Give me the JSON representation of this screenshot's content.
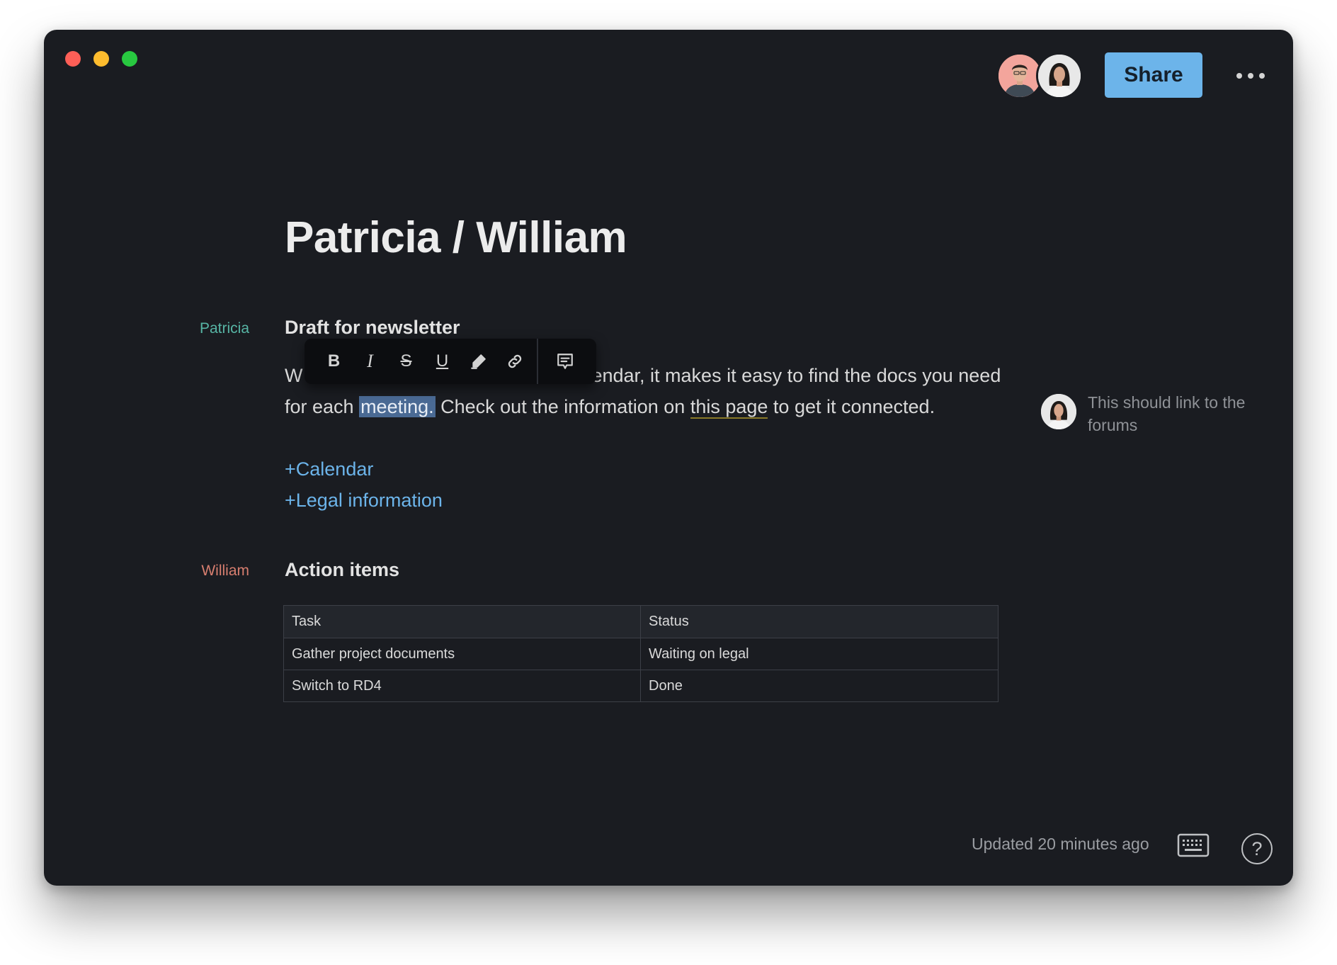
{
  "window": {
    "traffic_lights": [
      "close",
      "minimize",
      "maximize"
    ],
    "colors": {
      "close": "#fe5f57",
      "minimize": "#febc2e",
      "maximize": "#28c840",
      "background": "#1a1c21"
    }
  },
  "header": {
    "collaborators": [
      {
        "icon": "user-avatar-man",
        "color": "#f3a59c"
      },
      {
        "icon": "user-avatar-woman",
        "color": "#e8e8e8"
      }
    ],
    "share_label": "Share",
    "share_color": "#6cb4ea",
    "more_icon": "more-horizontal-icon"
  },
  "document": {
    "title": "Patricia / William",
    "sections": [
      {
        "author": "Patricia",
        "author_color": "#57b5a5",
        "heading": "Draft for newsletter",
        "paragraph": {
          "part1": "W",
          "part2": "lendar, it makes it easy to find the docs you need for each ",
          "highlighted": "meeting.",
          "part3": " Check out the information on ",
          "link": "this page",
          "part4": " to get it connected."
        },
        "links": [
          "+Calendar",
          "+Legal information"
        ]
      },
      {
        "author": "William",
        "author_color": "#d77e6f",
        "heading": "Action items",
        "table": {
          "headers": [
            "Task",
            "Status"
          ],
          "rows": [
            [
              "Gather project documents",
              "Waiting on legal"
            ],
            [
              "Switch to RD4",
              "Done"
            ]
          ]
        }
      }
    ]
  },
  "format_toolbar": {
    "buttons": [
      {
        "label": "B",
        "icon": "bold-icon"
      },
      {
        "label": "I",
        "icon": "italic-icon"
      },
      {
        "label": "S",
        "icon": "strikethrough-icon"
      },
      {
        "label": "U",
        "icon": "underline-icon"
      },
      {
        "label": "",
        "icon": "highlighter-icon"
      },
      {
        "label": "",
        "icon": "link-icon"
      },
      {
        "label": "",
        "icon": "comment-icon"
      }
    ]
  },
  "comment": {
    "text": "This should link to the forums",
    "avatar_icon": "user-avatar-woman"
  },
  "footer": {
    "updated": "Updated 20 minutes ago",
    "keyboard_icon": "keyboard-icon",
    "help_label": "?",
    "help_icon": "help-icon"
  }
}
